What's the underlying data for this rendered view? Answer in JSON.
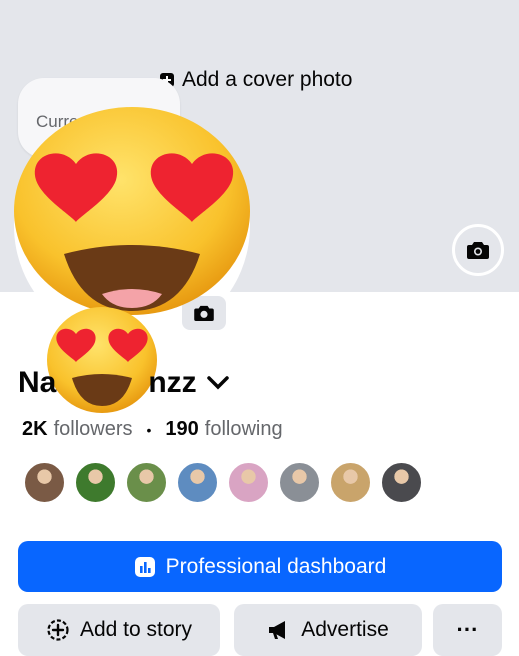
{
  "cover": {
    "add_cover_label": "Add a cover photo"
  },
  "note": {
    "text": "Curre"
  },
  "profile": {
    "name_start": "Na",
    "name_end": "nzz",
    "followers_count": "2K",
    "followers_label": "followers",
    "following_count": "190",
    "following_label": "following"
  },
  "friends": [
    {
      "color": "#7a5a45"
    },
    {
      "color": "#3e7a2d"
    },
    {
      "color": "#6a8f4a"
    },
    {
      "color": "#5e8cc0"
    },
    {
      "color": "#d9a4c3"
    },
    {
      "color": "#8a8f96"
    },
    {
      "color": "#c9a46b"
    },
    {
      "color": "#4a4a4e"
    }
  ],
  "buttons": {
    "dashboard": "Professional dashboard",
    "add_story": "Add to story",
    "advertise": "Advertise",
    "more": "···"
  },
  "colors": {
    "primary": "#0866ff",
    "secondary_bg": "#e4e6eb",
    "cover_bg": "#e4e6eb"
  },
  "icons": [
    "add-cover-icon",
    "camera-icon",
    "chevron-down-icon",
    "dashboard-icon",
    "add-story-icon",
    "megaphone-icon",
    "heart-eyes-emoji"
  ]
}
